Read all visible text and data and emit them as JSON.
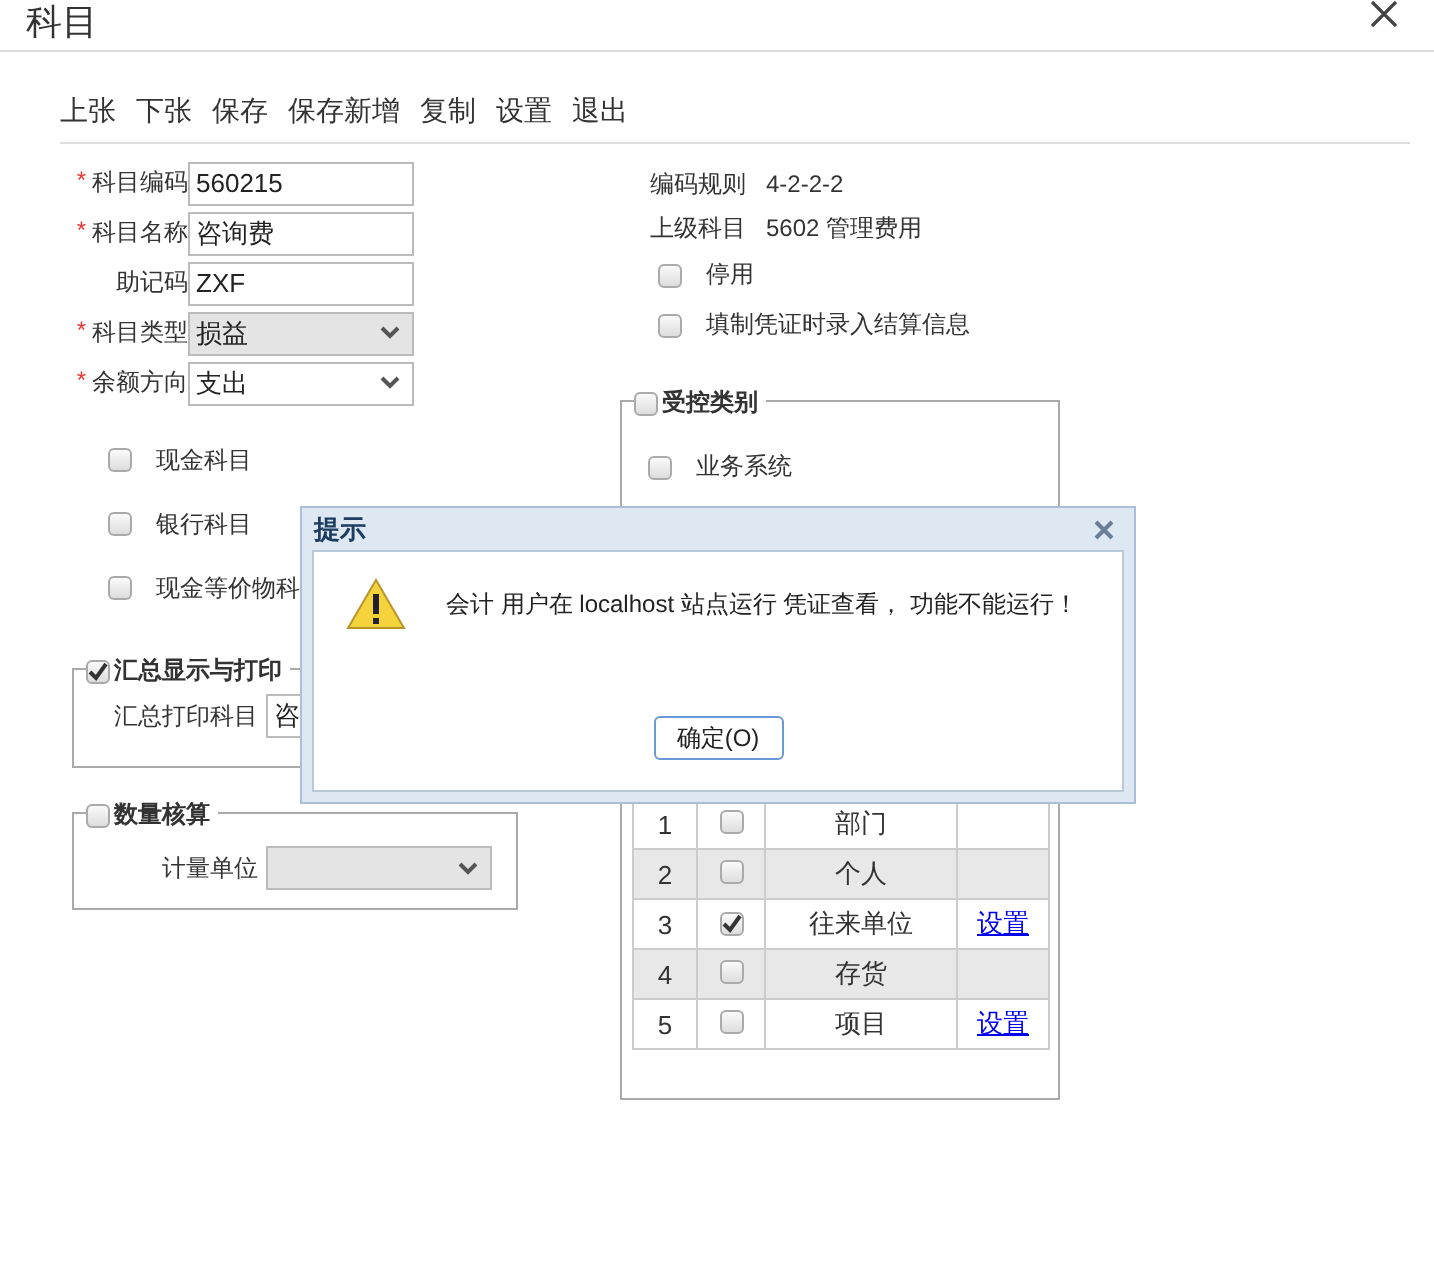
{
  "window": {
    "title": "科目"
  },
  "toolbar": [
    "上张",
    "下张",
    "保存",
    "保存新增",
    "复制",
    "设置",
    "退出"
  ],
  "fields": [
    {
      "required_mark": "*",
      "label": "科目编码",
      "kind": "text",
      "value": "560215",
      "disabled": false
    },
    {
      "required_mark": "*",
      "label": "科目名称",
      "kind": "text",
      "value": "咨询费",
      "disabled": false
    },
    {
      "label": "助记码",
      "kind": "text",
      "value": "ZXF",
      "disabled": false
    },
    {
      "required_mark": "*",
      "label": "科目类型",
      "kind": "select",
      "value": "损益",
      "disabled": true
    },
    {
      "required_mark": "*",
      "label": "余额方向",
      "kind": "select",
      "value": "支出",
      "disabled": false
    }
  ],
  "flags": [
    {
      "label": "现金科目",
      "checked": false
    },
    {
      "label": "银行科目",
      "checked": false
    },
    {
      "label": "现金等价物科",
      "checked": false
    }
  ],
  "info": [
    {
      "label": "编码规则",
      "value": "4-2-2-2"
    },
    {
      "label": "上级科目",
      "value": "5602 管理费用"
    }
  ],
  "options": [
    {
      "label": "停用",
      "checked": false
    },
    {
      "label": "填制凭证时录入结算信息",
      "checked": false
    }
  ],
  "summary_group": {
    "title": "汇总显示与打印",
    "checked": true,
    "field": {
      "label": "汇总打印科目",
      "value": "咨"
    }
  },
  "quantity_group": {
    "title": "数量核算",
    "checked": false,
    "field": {
      "label": "计量单位",
      "disabled": true
    }
  },
  "control_group": {
    "title": "受控类别",
    "checked": false,
    "items": [
      {
        "label": "业务系统",
        "checked": false
      }
    ],
    "rows": [
      {
        "index": "1",
        "checked": false,
        "name": "部门"
      },
      {
        "index": "2",
        "checked": false,
        "name": "个人"
      },
      {
        "index": "3",
        "checked": true,
        "name": "往来单位",
        "action": "设置"
      },
      {
        "index": "4",
        "checked": false,
        "name": "存货"
      },
      {
        "index": "5",
        "checked": false,
        "name": "项目",
        "action": "设置"
      }
    ]
  },
  "dialog": {
    "title": "提示",
    "message": "会计 用户在 localhost 站点运行 凭证查看， 功能不能运行！",
    "button": "确定(O)"
  }
}
